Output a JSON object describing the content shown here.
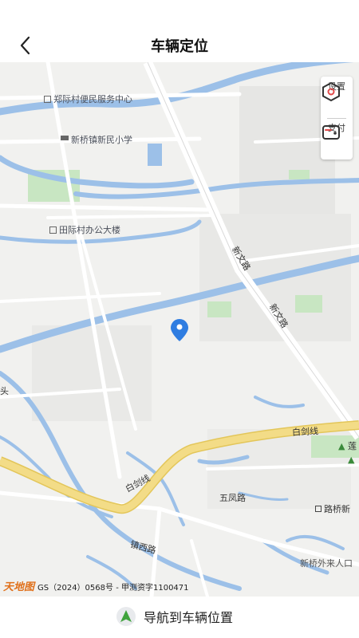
{
  "header": {
    "title": "车辆定位"
  },
  "map": {
    "pois": [
      {
        "name": "郑际村便民服务中心"
      },
      {
        "name": "新桥镇新民小学"
      },
      {
        "name": "田际村办公大楼"
      }
    ],
    "roads": [
      {
        "name": "新文路"
      },
      {
        "name": "新文路"
      },
      {
        "name": "白剑线"
      },
      {
        "name": "白剑线"
      },
      {
        "name": "五凤路"
      },
      {
        "name": "镇西路"
      },
      {
        "name": "路桥新"
      },
      {
        "name": "新桥外来人口"
      },
      {
        "name": "莲"
      },
      {
        "name": "头"
      }
    ],
    "controls": {
      "settings_label": "设置",
      "pay_label": "支付"
    },
    "copyright": {
      "logo": "天地图",
      "text": "GS（2024）0568号 - 甲测资字1100471"
    }
  },
  "footer": {
    "navigate_label": "导航到车辆位置"
  },
  "colors": {
    "water": "#9cc0e8",
    "main_road": "#f3dc87",
    "green": "#c8e6c2",
    "marker": "#2f7de1",
    "nav_arrow": "#3fa33c"
  }
}
